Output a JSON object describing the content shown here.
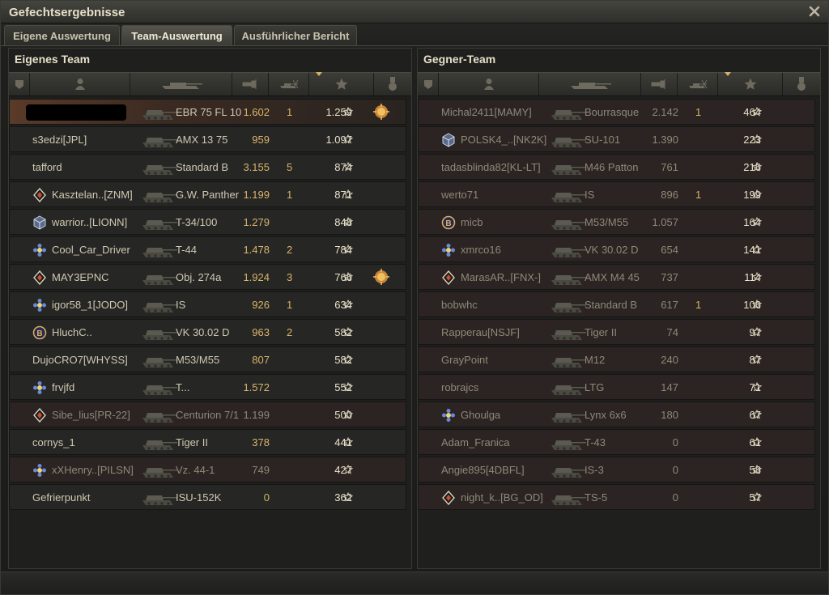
{
  "window": {
    "title": "Gefechtsergebnisse"
  },
  "tabs": [
    {
      "label": "Eigene Auswertung"
    },
    {
      "label": "Team-Auswertung"
    },
    {
      "label": "Ausführlicher Bericht"
    }
  ],
  "left": {
    "title": "Eigenes Team",
    "rows": [
      {
        "name": "",
        "vehicle": "EBR 75 FL 10",
        "damage": "1.602",
        "frags": "1",
        "xp": "1.259",
        "medal": true,
        "own": true
      },
      {
        "name": "s3edzi[JPL]",
        "vehicle": "AMX 13 75",
        "damage": "959",
        "frags": "",
        "xp": "1.097"
      },
      {
        "name": "tafford",
        "vehicle": "Standard B",
        "damage": "3.155",
        "frags": "5",
        "xp": "874"
      },
      {
        "name": "Kasztelan..[ZNM]",
        "vehicle": "G.W. Panther",
        "damage": "1.199",
        "frags": "1",
        "xp": "871",
        "icon": "diamond"
      },
      {
        "name": "warrior..[LIONN]",
        "vehicle": "T-34/100",
        "damage": "1.279",
        "frags": "",
        "xp": "848",
        "icon": "cube"
      },
      {
        "name": "Cool_Car_Driver",
        "vehicle": "T-44",
        "damage": "1.478",
        "frags": "2",
        "xp": "784",
        "icon": "flower"
      },
      {
        "name": "MAY3EPNC",
        "vehicle": "Obj. 274a",
        "damage": "1.924",
        "frags": "3",
        "xp": "766",
        "icon": "diamond",
        "medal": true
      },
      {
        "name": "igor58_1[JODO]",
        "vehicle": "IS",
        "damage": "926",
        "frags": "1",
        "xp": "634",
        "icon": "flower"
      },
      {
        "name": "HluchC..",
        "vehicle": "VK 30.02 D",
        "damage": "963",
        "frags": "2",
        "xp": "582",
        "icon": "coin"
      },
      {
        "name": "DujoCRO7[WHYSS]",
        "vehicle": "M53/M55",
        "damage": "807",
        "frags": "",
        "xp": "582"
      },
      {
        "name": "frvjfd",
        "vehicle": "T...",
        "damage": "1.572",
        "frags": "",
        "xp": "552",
        "icon": "flower"
      },
      {
        "name": "Sibe_lius[PR-22]",
        "vehicle": "Centurion 7/1",
        "damage": "1.199",
        "frags": "",
        "xp": "500",
        "icon": "diamond",
        "dead": true
      },
      {
        "name": "cornys_1",
        "vehicle": "Tiger II",
        "damage": "378",
        "frags": "",
        "xp": "441"
      },
      {
        "name": "xXHenry..[PILSN]",
        "vehicle": "Vz. 44-1",
        "damage": "749",
        "frags": "",
        "xp": "427",
        "icon": "flower",
        "dead": true
      },
      {
        "name": "Gefrierpunkt",
        "vehicle": "ISU-152K",
        "damage": "0",
        "frags": "",
        "xp": "362"
      }
    ]
  },
  "right": {
    "title": "Gegner-Team",
    "rows": [
      {
        "name": "Michal2411[MAMY]",
        "vehicle": "Bourrasque",
        "damage": "2.142",
        "frags": "1",
        "xp": "464",
        "dead": true
      },
      {
        "name": "POLSK4_..[NK2K]",
        "vehicle": "SU-101",
        "damage": "1.390",
        "frags": "",
        "xp": "223",
        "icon": "cube",
        "dead": true
      },
      {
        "name": "tadasblinda82[KL-LT]",
        "vehicle": "M46 Patton",
        "damage": "761",
        "frags": "",
        "xp": "216",
        "dead": true
      },
      {
        "name": "werto71",
        "vehicle": "IS",
        "damage": "896",
        "frags": "1",
        "xp": "199",
        "dead": true
      },
      {
        "name": "micb",
        "vehicle": "M53/M55",
        "damage": "1.057",
        "frags": "",
        "xp": "164",
        "icon": "coin",
        "dead": true
      },
      {
        "name": "xmrco16",
        "vehicle": "VK 30.02 D",
        "damage": "654",
        "frags": "",
        "xp": "141",
        "icon": "flower",
        "dead": true
      },
      {
        "name": "MarasAR..[FNX-]",
        "vehicle": "AMX M4 45",
        "damage": "737",
        "frags": "",
        "xp": "114",
        "icon": "diamond",
        "dead": true
      },
      {
        "name": "bobwhc",
        "vehicle": "Standard B",
        "damage": "617",
        "frags": "1",
        "xp": "106",
        "dead": true
      },
      {
        "name": "Rapperau[NSJF]",
        "vehicle": "Tiger II",
        "damage": "74",
        "frags": "",
        "xp": "97",
        "dead": true
      },
      {
        "name": "GrayPoint",
        "vehicle": "M12",
        "damage": "240",
        "frags": "",
        "xp": "87",
        "dead": true
      },
      {
        "name": "robrajcs",
        "vehicle": "LTG",
        "damage": "147",
        "frags": "",
        "xp": "71",
        "dead": true
      },
      {
        "name": "Ghoulga",
        "vehicle": "Lynx 6x6",
        "damage": "180",
        "frags": "",
        "xp": "67",
        "icon": "flower",
        "dead": true
      },
      {
        "name": "Adam_Franica",
        "vehicle": "T-43",
        "damage": "0",
        "frags": "",
        "xp": "61",
        "dead": true
      },
      {
        "name": "Angie895[4DBFL]",
        "vehicle": "IS-3",
        "damage": "0",
        "frags": "",
        "xp": "58",
        "dead": true
      },
      {
        "name": "night_k..[BG_OD]",
        "vehicle": "TS-5",
        "damage": "0",
        "frags": "",
        "xp": "57",
        "icon": "diamond",
        "dead": true
      }
    ]
  }
}
